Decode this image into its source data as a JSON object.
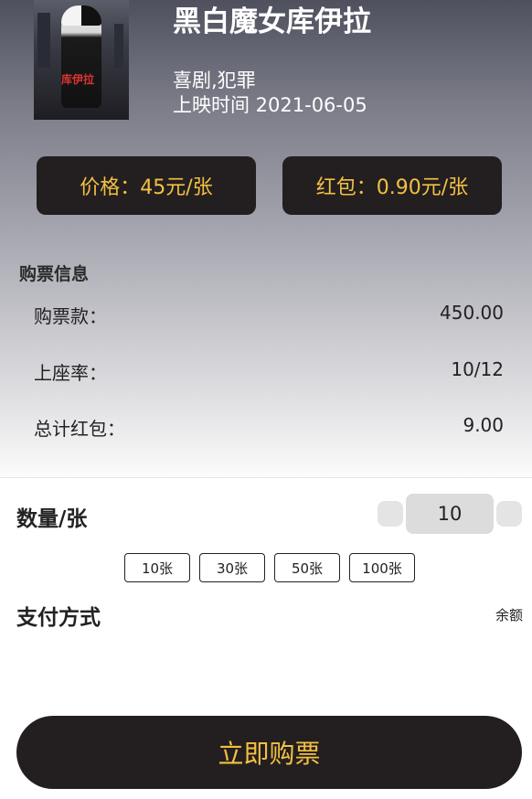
{
  "movie": {
    "title": "黑白魔女库伊拉",
    "genre": "喜剧,犯罪",
    "release": "上映时间 2021-06-05",
    "poster_text": "库伊拉"
  },
  "pricing": {
    "price": "价格：45元/张",
    "red_packet": "红包：0.90元/张"
  },
  "purchase_info": {
    "title": "购票信息",
    "rows": [
      {
        "label": "购票款：",
        "value": "450.00"
      },
      {
        "label": "上座率：",
        "value": "10/12"
      },
      {
        "label": "总计红包：",
        "value": "9.00"
      }
    ]
  },
  "quantity": {
    "label": "数量/张",
    "value": "10",
    "presets": [
      "10张",
      "30张",
      "50张",
      "100张"
    ]
  },
  "payment": {
    "label": "支付方式",
    "method": "余额"
  },
  "buy_button": "立即购票",
  "colors": {
    "accent": "#f3c042",
    "dark": "#231f20"
  }
}
